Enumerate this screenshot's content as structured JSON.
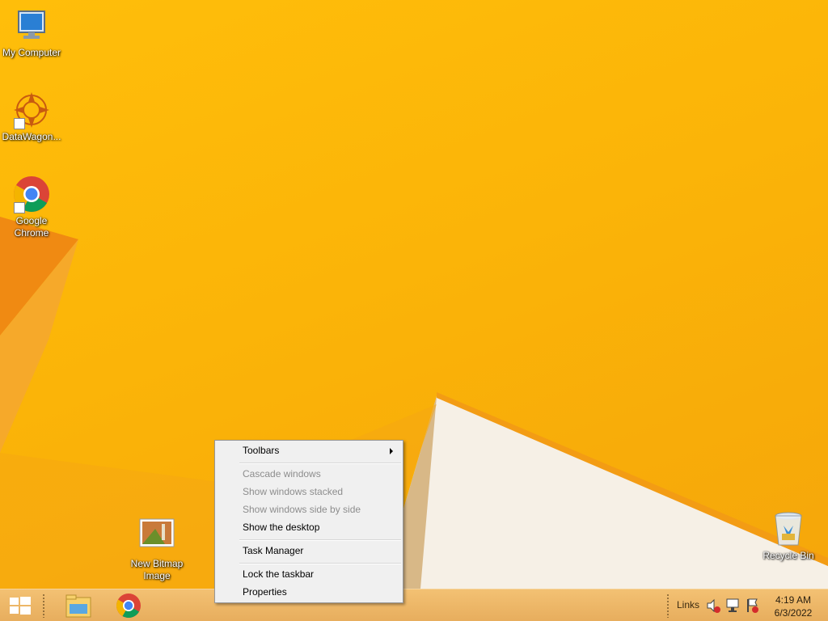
{
  "desktop": {
    "icons": [
      {
        "label": "My Computer",
        "icon": "computer-icon"
      },
      {
        "label": "DataWagon...",
        "icon": "datawagon-icon"
      },
      {
        "label": "Google Chrome",
        "icon": "chrome-icon"
      },
      {
        "label": "New Bitmap Image",
        "icon": "bitmap-image-icon"
      },
      {
        "label": "Recycle Bin",
        "icon": "recycle-bin-icon"
      }
    ]
  },
  "context_menu": {
    "items": [
      {
        "label": "Toolbars",
        "enabled": true,
        "submenu": true
      },
      {
        "label": "Cascade windows",
        "enabled": false
      },
      {
        "label": "Show windows stacked",
        "enabled": false
      },
      {
        "label": "Show windows side by side",
        "enabled": false
      },
      {
        "label": "Show the desktop",
        "enabled": true
      },
      {
        "label": "Task Manager",
        "enabled": true
      },
      {
        "label": "Lock the taskbar",
        "enabled": true
      },
      {
        "label": "Properties",
        "enabled": true
      }
    ]
  },
  "taskbar": {
    "start_icon": "windows-logo-icon",
    "pinned": [
      "file-explorer-icon",
      "chrome-icon"
    ],
    "links_label": "Links",
    "tray_icons": [
      "volume-muted-icon",
      "network-icon",
      "action-center-icon"
    ],
    "clock": {
      "time": "4:19 AM",
      "date": "6/3/2022"
    }
  },
  "colors": {
    "wallpaper": "#fbb408",
    "taskbar": "#eab465",
    "menu_bg": "#f0f0f0",
    "disabled_text": "#8d8d8d"
  }
}
